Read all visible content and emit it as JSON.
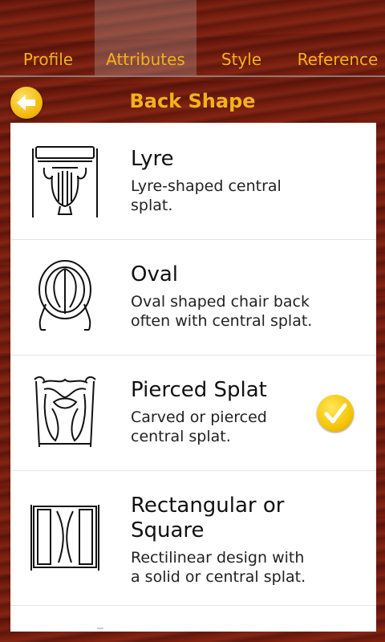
{
  "tabs": [
    {
      "label": "Profile",
      "active": false
    },
    {
      "label": "Attributes",
      "active": true
    },
    {
      "label": "Style",
      "active": false
    },
    {
      "label": "Reference",
      "active": false
    }
  ],
  "header": {
    "title": "Back Shape",
    "back_icon": "back-arrow-icon"
  },
  "items": [
    {
      "title": "Lyre",
      "description": "Lyre-shaped central splat.",
      "icon": "lyre-back-icon",
      "selected": false
    },
    {
      "title": "Oval",
      "description": "Oval shaped chair back often with central splat.",
      "icon": "oval-back-icon",
      "selected": false
    },
    {
      "title": "Pierced Splat",
      "description": "Carved or pierced central splat.",
      "icon": "pierced-splat-back-icon",
      "selected": true
    },
    {
      "title": "Rectangular or Square",
      "description": "Rectilinear design with a solid or central splat.",
      "icon": "rectangular-back-icon",
      "selected": false
    }
  ],
  "colors": {
    "accent": "#f3b21b",
    "wood": "#7a1f10",
    "check": "#f2c200"
  }
}
